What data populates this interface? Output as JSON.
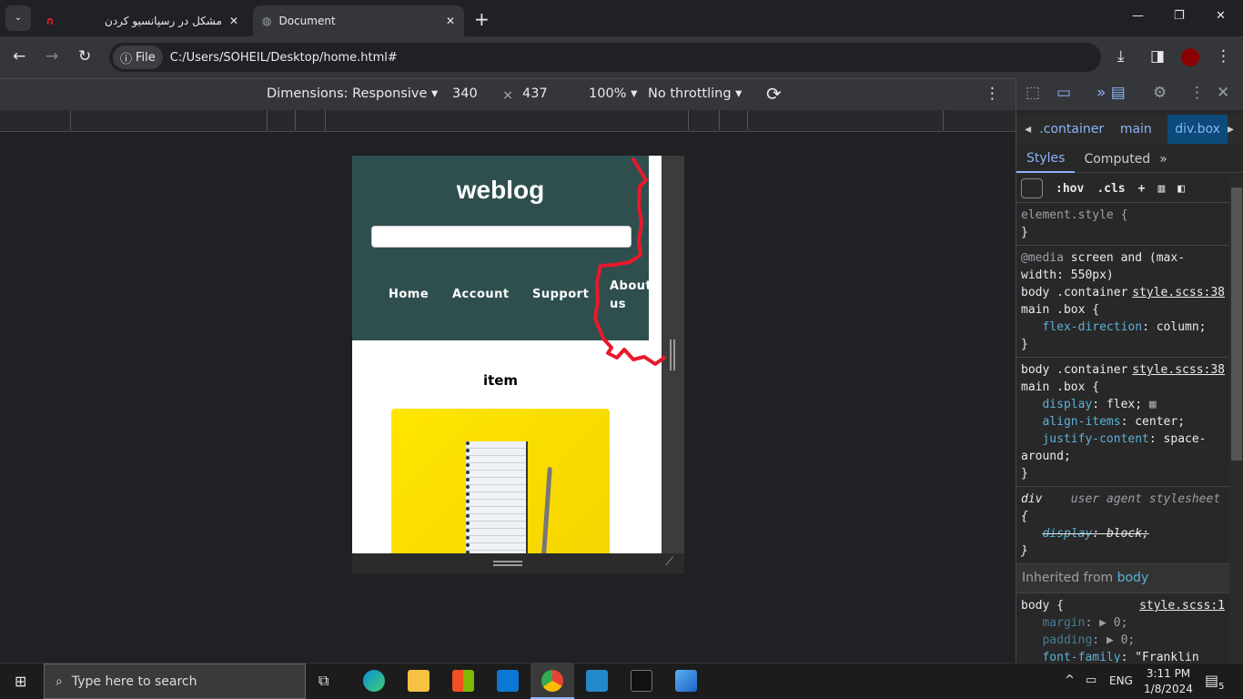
{
  "browser": {
    "tabs": [
      {
        "title": "مشکل در رسپانسیو کردن",
        "icon": "quora-icon"
      },
      {
        "title": "Document",
        "icon": "globe-icon",
        "active": true
      }
    ],
    "address": {
      "chip": "File",
      "url": "C:/Users/SOHEIL/Desktop/home.html#"
    }
  },
  "device_toolbar": {
    "dimensions": "Dimensions: Responsive",
    "width": "340",
    "times": "×",
    "height": "437",
    "zoom": "100%",
    "throttling": "No throttling"
  },
  "page": {
    "logo": "weblog",
    "nav": [
      "Home",
      "Account",
      "Support",
      "About",
      "us"
    ],
    "item_title": "item"
  },
  "devtools": {
    "breadcrumbs": [
      ".container",
      "main",
      "div.box"
    ],
    "tabs": [
      "Styles",
      "Computed"
    ],
    "filter_buttons": [
      ":hov",
      ".cls"
    ],
    "rules": {
      "element_style": "element.style {",
      "media": "@media",
      "media_query": " screen and (max-width: 550px)",
      "r1_sel": "body .container main .box {",
      "r1_src": "style.scss:38",
      "r1_prop": "flex-direction",
      "r1_val": "column;",
      "r2_sel": "body .container main .box {",
      "r2_src": "style.scss:38",
      "r2_p1": "display",
      "r2_v1": "flex;",
      "r2_p2": "align-items",
      "r2_v2": "center;",
      "r2_p3": "justify-content",
      "r2_v3": "space-around;",
      "ua_sel": "div",
      "ua_label": "user agent stylesheet",
      "ua_prop": "display",
      "ua_val": "block;",
      "inherited": "Inherited from",
      "inherited_el": "body",
      "body_sel": "body {",
      "body_src": "style.scss:1",
      "b_p1": "margin",
      "b_v1": "▶ 0;",
      "b_p2": "padding",
      "b_v2": "▶ 0;",
      "b_p3": "font-family",
      "b_v3": "\"Franklin Gothic Medium\""
    }
  },
  "taskbar": {
    "search_placeholder": "Type here to search",
    "time": "3:11 PM",
    "date": "1/8/2024",
    "lang": "ENG",
    "notifications": "5"
  },
  "colors": {
    "header": "#2f4f4f",
    "annotation": "#e8192c",
    "accent": "#8ab4f8"
  }
}
